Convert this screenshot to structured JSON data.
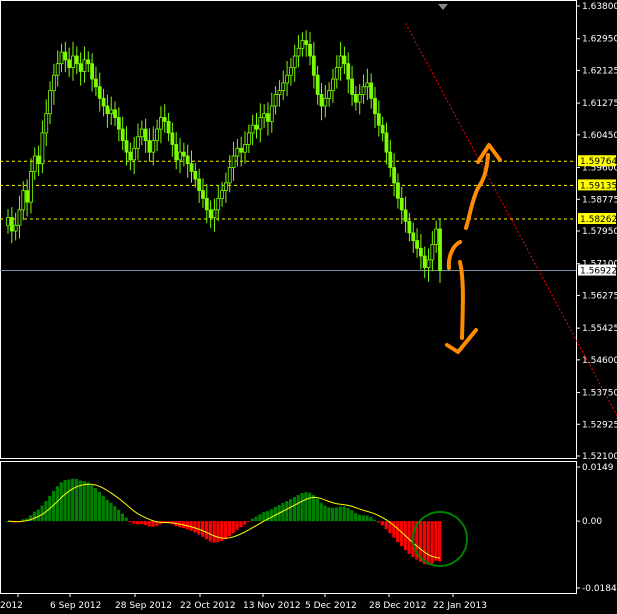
{
  "chart_data": [
    {
      "type": "candlestick",
      "pane": "price",
      "ylim": [
        1.521,
        1.638
      ],
      "y_ticks": [
        "1.63800",
        "1.62950",
        "1.62125",
        "1.61275",
        "1.60450",
        "1.59600",
        "1.58775",
        "1.57950",
        "1.57100",
        "1.56275",
        "1.55425",
        "1.54600",
        "1.53750",
        "1.52925",
        "1.52100"
      ],
      "x_ticks": [
        "2012",
        "6 Sep 2012",
        "28 Sep 2012",
        "22 Oct 2012",
        "13 Nov 2012",
        "5 Dec 2012",
        "28 Dec 2012",
        "22 Jan 2013"
      ],
      "current_price": {
        "label": "1.56922",
        "value": 1.56922,
        "color": "#ffffff"
      },
      "horizontal_levels": [
        {
          "label": "1.59764",
          "value": 1.59764,
          "color": "#ffff00"
        },
        {
          "label": "1.59135",
          "value": 1.59135,
          "color": "#ffff00"
        },
        {
          "label": "1.58262",
          "value": 1.58262,
          "color": "#ffff00"
        }
      ],
      "trendline": {
        "from": {
          "bar": 104,
          "price": 1.6335
        },
        "to": {
          "bar": 165,
          "price": 1.521
        },
        "color": "#ff0000"
      },
      "candle_color": "#7cfc00",
      "closes": [
        1.583,
        1.5795,
        1.581,
        1.585,
        1.59,
        1.587,
        1.595,
        1.599,
        1.597,
        1.605,
        1.61,
        1.616,
        1.62,
        1.623,
        1.626,
        1.624,
        1.622,
        1.625,
        1.623,
        1.621,
        1.624,
        1.623,
        1.619,
        1.617,
        1.614,
        1.612,
        1.61,
        1.611,
        1.609,
        1.606,
        1.603,
        1.6,
        1.598,
        1.601,
        1.604,
        1.606,
        1.603,
        1.6,
        1.603,
        1.606,
        1.609,
        1.608,
        1.605,
        1.602,
        1.598,
        1.6,
        1.599,
        1.597,
        1.595,
        1.593,
        1.59,
        1.588,
        1.585,
        1.583,
        1.585,
        1.588,
        1.59,
        1.592,
        1.596,
        1.599,
        1.601,
        1.6,
        1.602,
        1.605,
        1.607,
        1.606,
        1.609,
        1.61,
        1.608,
        1.612,
        1.615,
        1.616,
        1.618,
        1.62,
        1.622,
        1.625,
        1.627,
        1.629,
        1.628,
        1.625,
        1.62,
        1.615,
        1.612,
        1.614,
        1.616,
        1.619,
        1.622,
        1.625,
        1.623,
        1.619,
        1.615,
        1.613,
        1.615,
        1.617,
        1.618,
        1.614,
        1.61,
        1.607,
        1.605,
        1.6,
        1.596,
        1.592,
        1.588,
        1.585,
        1.582,
        1.579,
        1.577,
        1.575,
        1.573,
        1.57,
        1.572,
        1.576,
        1.58,
        1.5692
      ],
      "annotations": [
        {
          "kind": "arrow-up",
          "color": "#ff8c00"
        },
        {
          "kind": "arrow-down",
          "color": "#ff8c00"
        }
      ]
    },
    {
      "type": "bar",
      "pane": "macd",
      "ylim": [
        -0.0184,
        0.0149
      ],
      "y_ticks": [
        "0.0149",
        "0.00",
        "-0.0184"
      ],
      "positive_color": "#008000",
      "negative_color": "#ff0000",
      "signal_color": "#ffff00",
      "circle_color": "#008000"
    }
  ]
}
